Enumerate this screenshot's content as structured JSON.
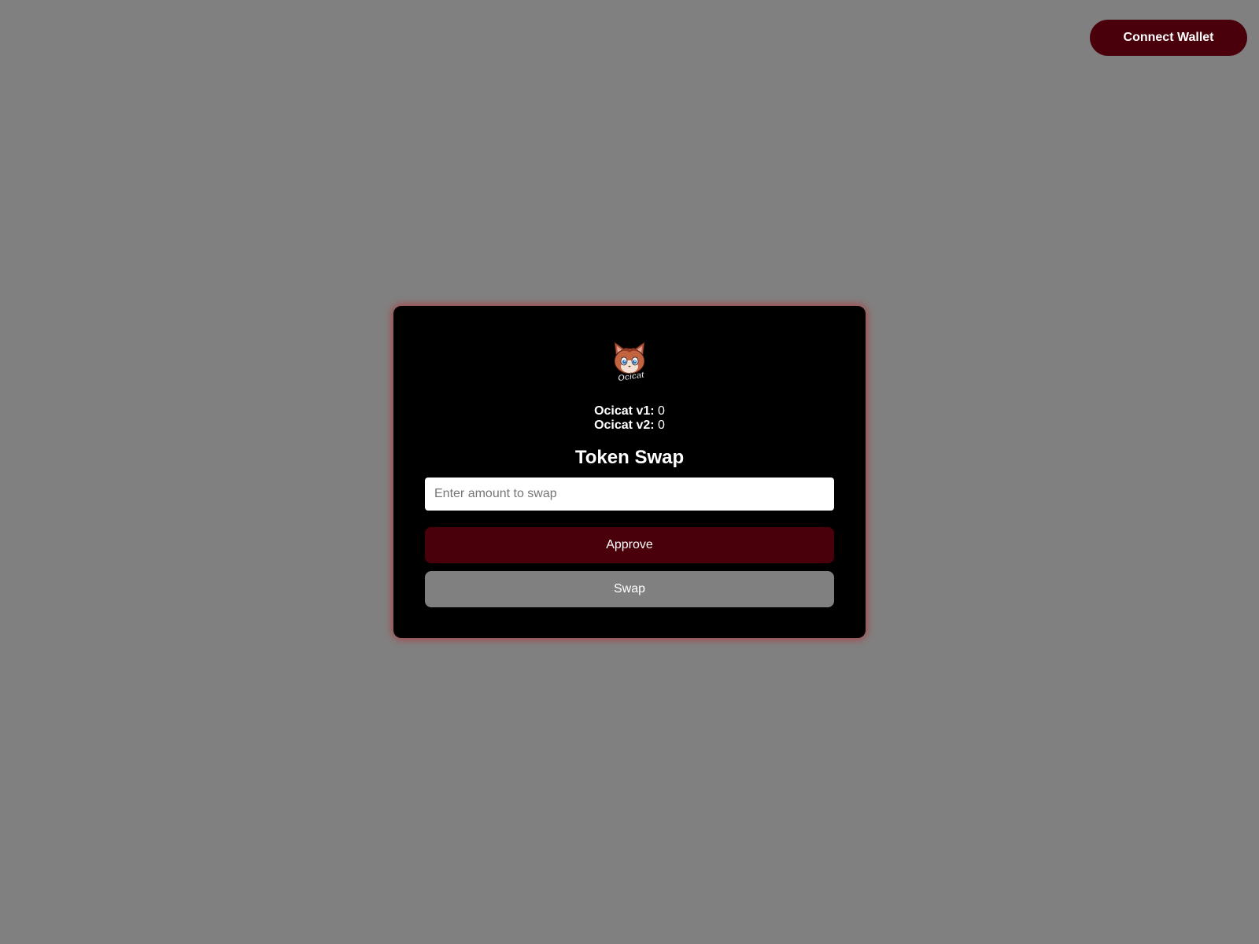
{
  "header": {
    "connect_label": "Connect Wallet"
  },
  "card": {
    "logo_text": "Ocicat",
    "balances": [
      {
        "label": "Ocicat v1:",
        "value": "0"
      },
      {
        "label": "Ocicat v2:",
        "value": "0"
      }
    ],
    "title": "Token Swap",
    "amount_placeholder": "Enter amount to swap",
    "approve_label": "Approve",
    "swap_label": "Swap"
  },
  "colors": {
    "page_background": "#808080",
    "card_background": "#000000",
    "accent": "#4a000a",
    "card_glow": "#c8141e",
    "disabled_button": "#808080"
  },
  "icons": {
    "logo": "ocicat-cat-face-logo"
  }
}
